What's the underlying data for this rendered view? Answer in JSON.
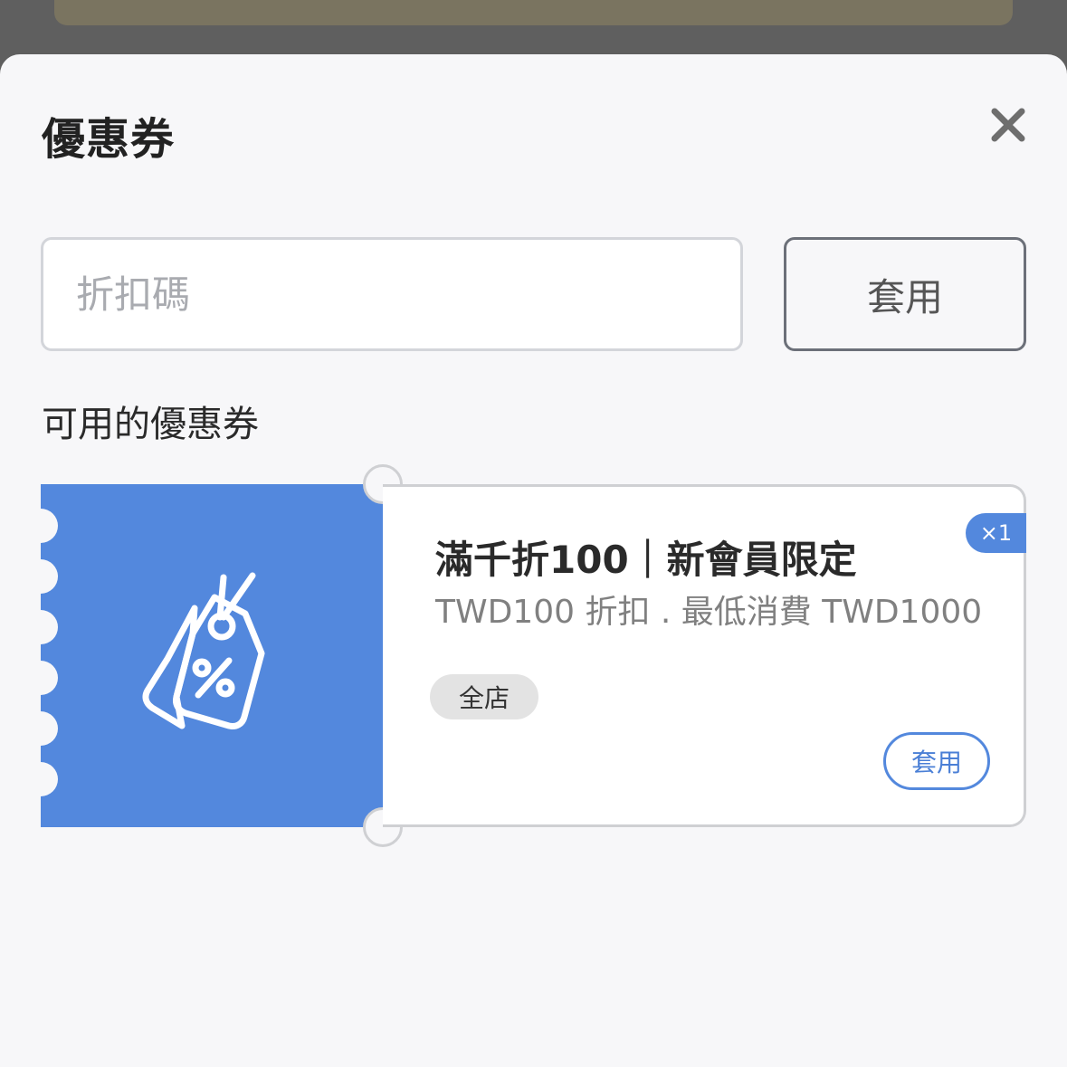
{
  "sheet": {
    "title": "優惠券",
    "close_icon": "close-icon"
  },
  "code_entry": {
    "placeholder": "折扣碼",
    "value": "",
    "apply_label": "套用"
  },
  "available": {
    "label": "可用的優惠券",
    "coupons": [
      {
        "title": "滿千折100｜新會員限定",
        "description": "TWD100 折扣 . 最低消費 TWD1000",
        "quantity": "×1",
        "scope": "全店",
        "apply_label": "套用",
        "icon": "discount-tag-icon"
      }
    ]
  },
  "colors": {
    "accent": "#5388dd",
    "sheet_bg": "#f7f7f9",
    "backdrop": "#5f5f5f"
  }
}
